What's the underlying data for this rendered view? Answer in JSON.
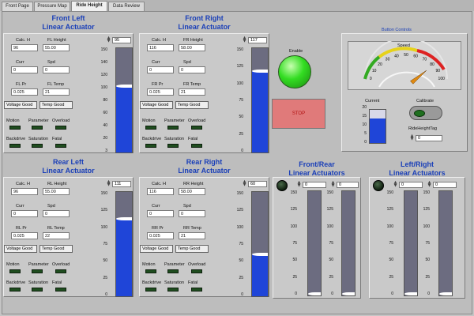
{
  "tabs": [
    {
      "label": "Front Page"
    },
    {
      "label": "Pressure Map"
    },
    {
      "label": "Ride Height"
    },
    {
      "label": "Data Review"
    }
  ],
  "actuators": {
    "fl": {
      "title1": "Front Left",
      "title2": "Linear Actuator",
      "calc_label": "Calc. H",
      "calc_value": "96",
      "height_label": "FL Height",
      "height_value": "55.00",
      "curr_label": "Curr",
      "curr_value": "0",
      "spd_label": "Spd",
      "spd_value": "0",
      "pr_label": "FL Pr",
      "pr_value": "0.025",
      "temp_label": "FL Temp",
      "temp_value": "21",
      "status1": "Voltage Good",
      "status2": "Temp Good",
      "led_labels": [
        "Motion",
        "Parameter",
        "Overload",
        "Backdrive",
        "Saturation",
        "Fatal"
      ],
      "bar_value": "95",
      "ticks": [
        "150",
        "140",
        "120",
        "100",
        "80",
        "60",
        "40",
        "20",
        "3"
      ],
      "level": 95
    },
    "fr": {
      "title1": "Front Right",
      "title2": "Linear Actuator",
      "calc_label": "Calc. H",
      "calc_value": "116",
      "height_label": "FR Height",
      "height_value": "58.00",
      "curr_label": "Curr",
      "curr_value": "0",
      "spd_label": "Spd",
      "spd_value": "0",
      "pr_label": "FR Pr",
      "pr_value": "0.025",
      "temp_label": "FR Temp",
      "temp_value": "21",
      "status1": "Voltage Good",
      "status2": "Temp Good",
      "led_labels": [
        "Motion",
        "Parameter",
        "Overload",
        "Backdrive",
        "Saturation",
        "Fatal"
      ],
      "bar_value": "117",
      "ticks": [
        "150",
        "125",
        "100",
        "75",
        "50",
        "25",
        "0"
      ],
      "level": 117
    },
    "rl": {
      "title1": "Rear Left",
      "title2": "Linear Actuator",
      "calc_label": "Calc. H",
      "calc_value": "96",
      "height_label": "RL Height",
      "height_value": "55.00",
      "curr_label": "Curr",
      "curr_value": "0",
      "spd_label": "Spd",
      "spd_value": "0",
      "pr_label": "RL Pr",
      "pr_value": "0.025",
      "temp_label": "RL Temp",
      "temp_value": "22",
      "status1": "Voltage Good",
      "status2": "Temp Good",
      "led_labels": [
        "Motion",
        "Parameter",
        "Overload",
        "Backdrive",
        "Saturation",
        "Fatal"
      ],
      "bar_value": "111",
      "ticks": [
        "150",
        "125",
        "100",
        "75",
        "50",
        "25",
        "0"
      ],
      "level": 111
    },
    "rr": {
      "title1": "Rear Right",
      "title2": "Linear Actuator",
      "calc_label": "Calc. H",
      "calc_value": "116",
      "height_label": "RR Height",
      "height_value": "58.00",
      "curr_label": "Curr",
      "curr_value": "0",
      "spd_label": "Spd",
      "spd_value": "0",
      "pr_label": "RR Pr",
      "pr_value": "0.025",
      "temp_label": "RR Temp",
      "temp_value": "21",
      "status1": "Voltage Good",
      "status2": "Temp Good",
      "led_labels": [
        "Motion",
        "Parameter",
        "Overload",
        "Backdrive",
        "Saturation",
        "Fatal"
      ],
      "bar_value": "60",
      "ticks": [
        "150",
        "125",
        "100",
        "75",
        "50",
        "25",
        "0"
      ],
      "level": 60
    }
  },
  "enable_label": "Enable",
  "stop_label": "STOP",
  "button_controls": {
    "title": "Button Controls",
    "speed_label": "Speed",
    "speed_ticks": [
      "0",
      "10",
      "20",
      "30",
      "40",
      "50",
      "60",
      "70",
      "80",
      "90",
      "100"
    ],
    "speed_value": 80,
    "current_label": "Current",
    "current_ticks": [
      "20",
      "15",
      "10",
      "5",
      "0"
    ],
    "current_value": 15,
    "calibrate_label": "Calibrate",
    "ride_height_tag_label": "RideHeightTag",
    "ride_height_tag_value": "0"
  },
  "pairs": {
    "front_rear": {
      "title1": "Front/Rear",
      "title2": "Linear Actuators",
      "value_a": "0",
      "value_b": "0",
      "ticks": [
        "150",
        "125",
        "100",
        "75",
        "50",
        "25",
        "0"
      ]
    },
    "left_right": {
      "title1": "Left/Right",
      "title2": "Linear Actuators",
      "value_a": "0",
      "value_b": "0",
      "ticks": [
        "150",
        "125",
        "100",
        "75",
        "50",
        "25",
        "0"
      ]
    }
  },
  "colors": {
    "title_blue": "#1a3fb8",
    "bar_fill": "#1f45d8",
    "bar_empty": "#6c6c80",
    "led_off": "#1f4d1f",
    "enable_green": "#33dd22"
  }
}
